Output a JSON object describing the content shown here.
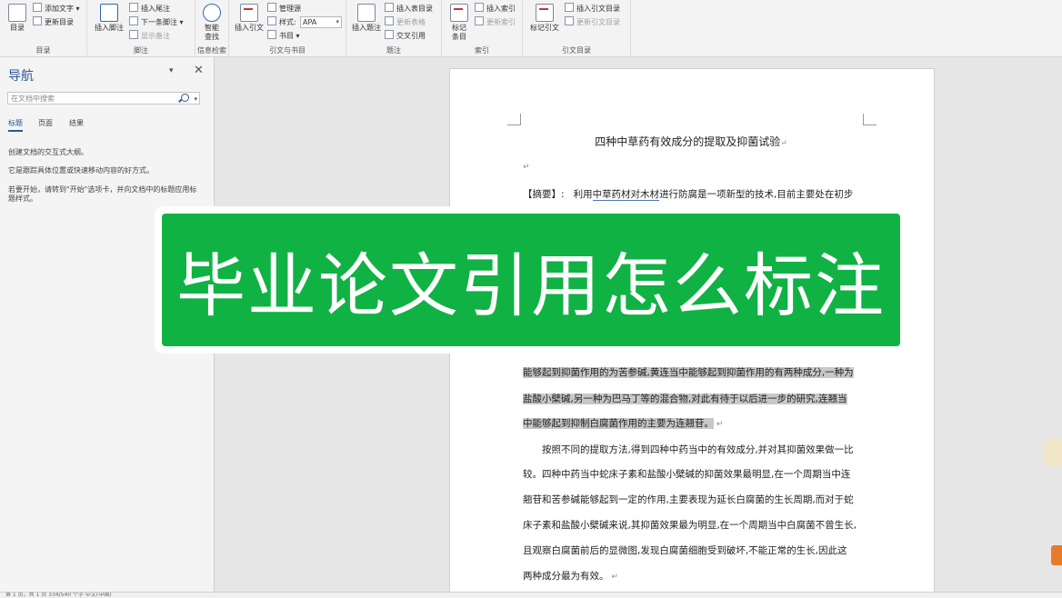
{
  "ribbon": {
    "groups": {
      "toc": "目录",
      "footnotes": "脚注",
      "research": "信息检索",
      "citations": "引文与书目",
      "captions": "题注",
      "index": "索引",
      "authorities": "引文目录"
    },
    "buttons": {
      "toc": "目录",
      "add_text": "添加文字",
      "update_table": "更新目录",
      "insert_footnote": "插入脚注",
      "insert_endnote": "插入尾注",
      "next_footnote": "下一条脚注",
      "show_notes": "显示备注",
      "smart_lookup_1": "智能",
      "smart_lookup_2": "查找",
      "insert_citation": "插入引文",
      "manage_sources": "管理源",
      "style_label": "样式:",
      "style_value": "APA",
      "bibliography": "书目",
      "insert_caption": "插入题注",
      "insert_table_of_figures": "插入表目录",
      "update_table_figures": "更新表格",
      "cross_reference": "交叉引用",
      "mark_entry_1": "标记",
      "mark_entry_2": "条目",
      "insert_index": "插入索引",
      "update_index": "更新索引",
      "mark_citation": "标记引文",
      "insert_table_authorities": "插入引文目录",
      "update_table_authorities": "更新引文目录"
    }
  },
  "nav": {
    "title": "导航",
    "search_placeholder": "在文档中搜索",
    "tabs": [
      "标题",
      "页面",
      "结果"
    ],
    "text1": "创建文档的交互式大纲。",
    "text2": "它是跟踪具体位置或快速移动内容的好方式。",
    "text3": "若要开始，请转到\"开始\"选项卡，并向文档中的标题应用标题样式。"
  },
  "document": {
    "title": "四种中草药有效成分的提取及抑菌试验",
    "abstract": {
      "label": "【摘要】:",
      "text_a": "利用",
      "text_b": "中草药材对木材",
      "text_c": "进行防腐是一项新型的技术,目前主要处在初步"
    },
    "hl_lines": [
      "能够起到抑菌作用的为苦参碱,黄连当中能够起到抑菌作用的有两种成分,一种为",
      "盐酸小檗碱,另一种为巴马丁等的混合物,对此有待于以后进一步的研究,连翘当",
      "中能够起到抑制白腐菌作用的主要为连翘苷。"
    ],
    "body_lines": [
      "按照不同的提取方法,得到四种中药当中的有效成分,并对其抑菌效果做一比",
      "较。四种中药当中蛇床子素和盐酸小檗碱的抑菌效果最明显,在一个周期当中连",
      "翘苷和苦参碱能够起到一定的作用,主要表现为延长白腐菌的生长周期,而对于蛇",
      "床子素和盐酸小檗碱来说,其抑菌效果最为明显,在一个周期当中白腐菌不曾生长,",
      "且观察白腐菌前后的显微图,发现白腐菌细胞受到破坏,不能正常的生长,因此这",
      "两种成分最为有效。"
    ]
  },
  "banner": {
    "text": "毕业论文引用怎么标注"
  },
  "status": {
    "text": "第 1 页，共 1 页    334/540 个字    中文(中国)"
  },
  "colors": {
    "banner_green": "#10b244",
    "accent_blue": "#2b579a"
  }
}
